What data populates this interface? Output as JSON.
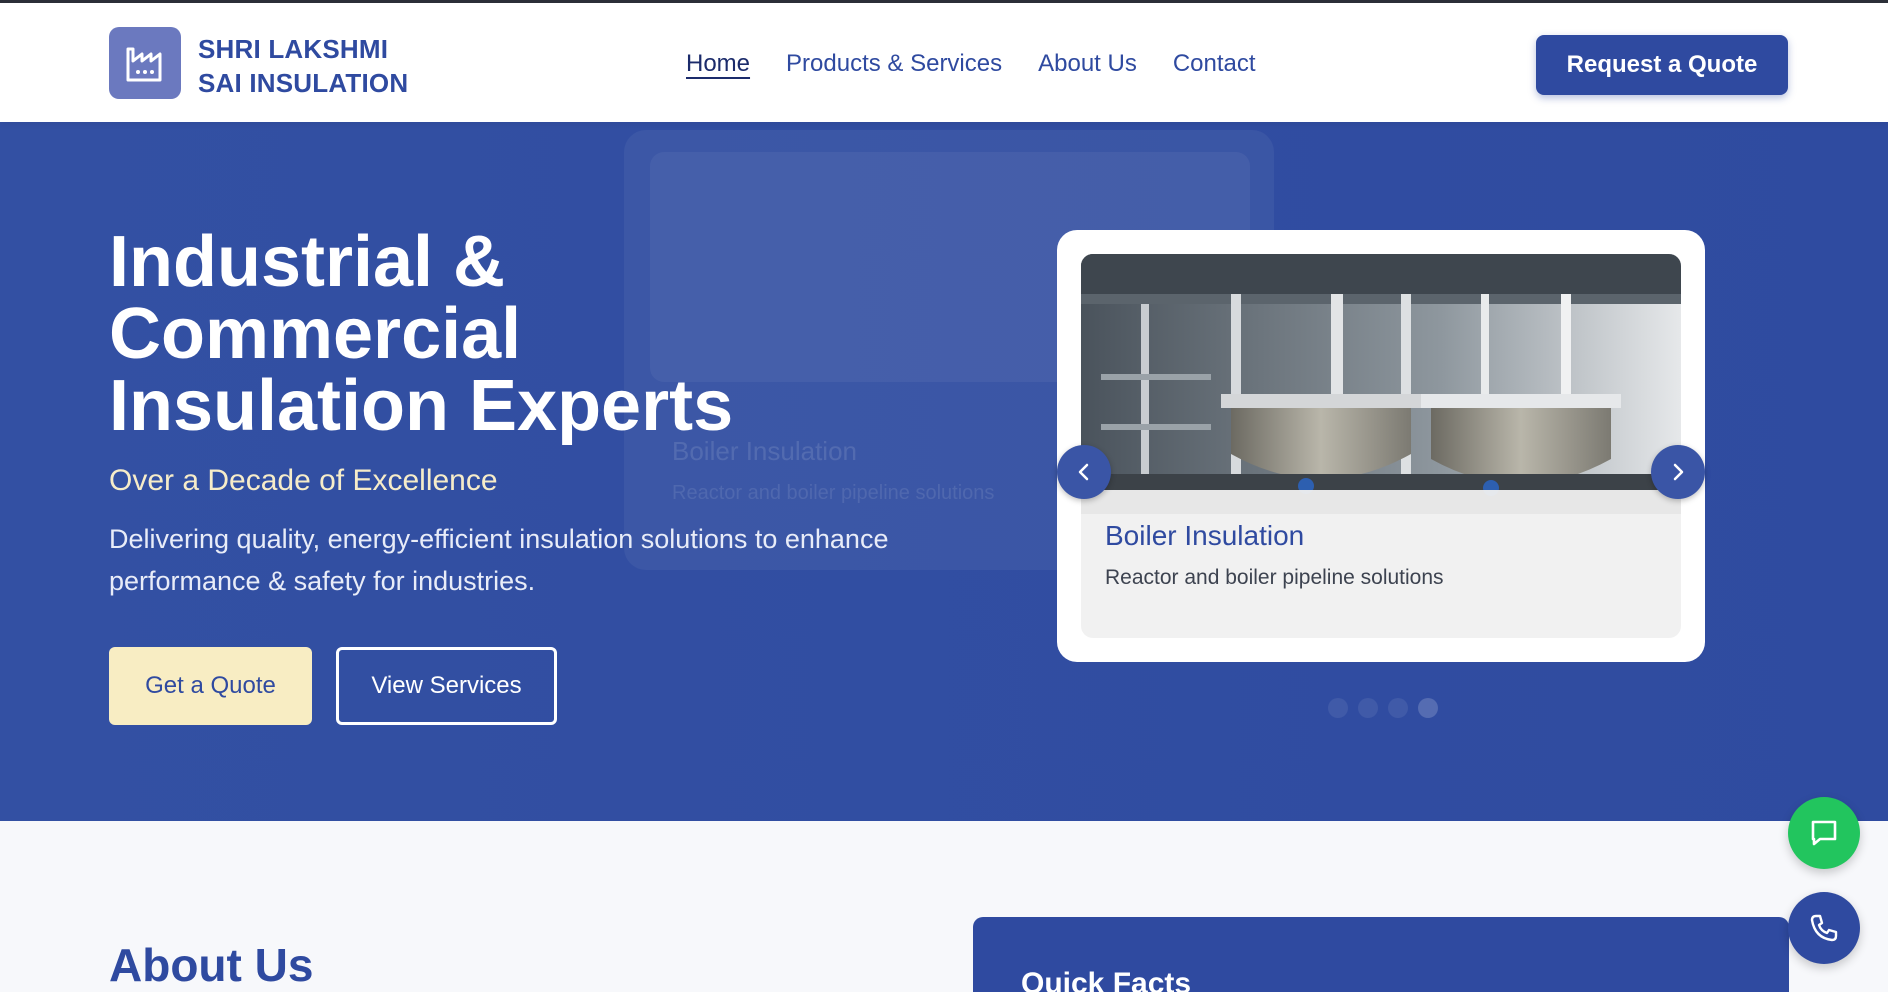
{
  "header": {
    "brand_line1": "SHRI LAKSHMI",
    "brand_line2": "SAI INSULATION",
    "logo_icon": "factory-icon",
    "nav": [
      {
        "label": "Home",
        "active": true
      },
      {
        "label": "Products & Services",
        "active": false
      },
      {
        "label": "About Us",
        "active": false
      },
      {
        "label": "Contact",
        "active": false
      }
    ],
    "cta_label": "Request a Quote"
  },
  "hero": {
    "title_line1": "Industrial &",
    "title_line2": "Commercial",
    "title_line3": "Insulation Experts",
    "subtitle": "Over a Decade of Excellence",
    "description": "Delivering quality, energy-efficient insulation solutions to enhance performance & safety for industries.",
    "primary_button": "Get a Quote",
    "secondary_button": "View Services"
  },
  "carousel": {
    "active_slide": {
      "title": "Boiler Insulation",
      "text": "Reactor and boiler pipeline solutions"
    },
    "ghost_slide": {
      "title": "Boiler Insulation",
      "text": "Reactor and boiler pipeline solutions"
    },
    "prev_icon": "chevron-left-icon",
    "next_icon": "chevron-right-icon",
    "slide_count": 4,
    "active_index": 3
  },
  "about": {
    "title": "About Us",
    "facts_title": "Quick Facts"
  },
  "floating": {
    "chat_icon": "chat-icon",
    "phone_icon": "phone-icon"
  },
  "colors": {
    "primary": "#2f4aa0",
    "hero_bg": "#3350a3",
    "accent_cream": "#f8edc3",
    "chat_green": "#22c55e",
    "white": "#ffffff"
  }
}
